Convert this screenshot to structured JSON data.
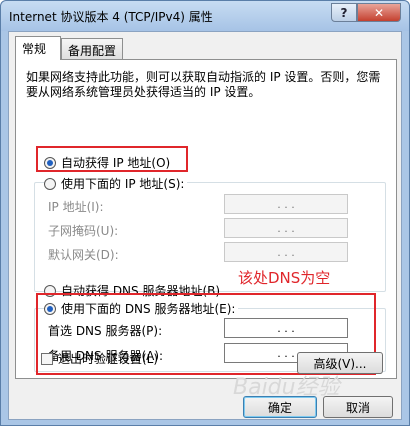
{
  "window": {
    "title": "Internet 协议版本 4 (TCP/IPv4) 属性",
    "help_glyph": "?",
    "close_glyph": "✕"
  },
  "tabs": [
    {
      "label": "常规"
    },
    {
      "label": "备用配置"
    }
  ],
  "description": "如果网络支持此功能，则可以获取自动指派的 IP 设置。否则，您需要从网络系统管理员处获得适当的 IP 设置。",
  "ip": {
    "auto_label": "自动获得 IP 地址(O)",
    "manual_label": "使用下面的 IP 地址(S):",
    "fields": [
      {
        "label": "IP 地址(I):",
        "value": ".   .   ."
      },
      {
        "label": "子网掩码(U):",
        "value": ".   .   ."
      },
      {
        "label": "默认网关(D):",
        "value": ".   .   ."
      }
    ]
  },
  "dns": {
    "auto_label": "自动获得 DNS 服务器地址(B)",
    "manual_label": "使用下面的 DNS 服务器地址(E):",
    "fields": [
      {
        "label": "首选 DNS 服务器(P):",
        "value": ".   .   ."
      },
      {
        "label": "备用 DNS 服务器(A):",
        "value": ".   .   ."
      }
    ]
  },
  "annotation": "该处DNS为空",
  "validate_label": "退出时验证设置(L)",
  "advanced_label": "高级(V)...",
  "ok_label": "确定",
  "cancel_label": "取消",
  "watermark": "Baidu经验",
  "colors": {
    "annotation_red": "#e0262b",
    "selected_radio": "#2060c0"
  }
}
